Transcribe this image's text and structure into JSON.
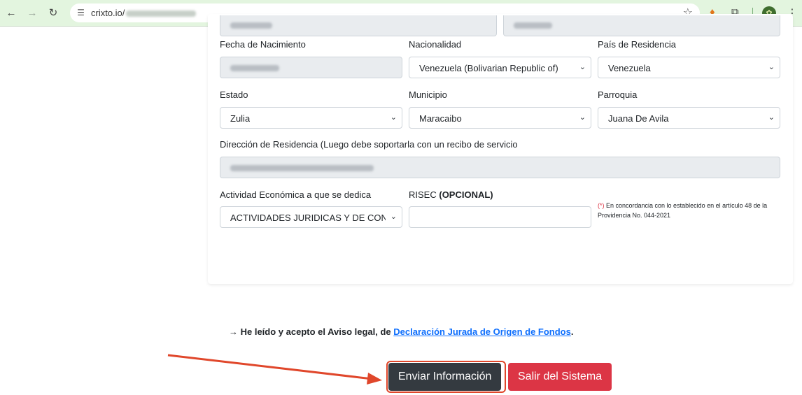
{
  "browser": {
    "url_visible": "crixto.io/",
    "back_icon": "←",
    "forward_icon": "→",
    "reload_icon": "↻",
    "site_info_icon": "☰",
    "star_icon": "☆",
    "fox_icon": "♦",
    "puzzle_icon": "⧉",
    "profile_icon": "✿",
    "menu_icon": "⋮"
  },
  "form": {
    "birth_date": {
      "label": "Fecha de Nacimiento"
    },
    "nationality": {
      "label": "Nacionalidad",
      "value": "Venezuela (Bolivarian Republic of)"
    },
    "country": {
      "label": "País de Residencia",
      "value": "Venezuela"
    },
    "state": {
      "label": "Estado",
      "value": "Zulia"
    },
    "municipality": {
      "label": "Municipio",
      "value": "Maracaibo"
    },
    "parish": {
      "label": "Parroquia",
      "value": "Juana De Avila"
    },
    "address": {
      "label": "Dirección de Residencia (Luego debe soportarla con un recibo de servicio"
    },
    "activity": {
      "label": "Actividad Económica a que se dedica",
      "value": "ACTIVIDADES JURIDICAS Y DE CONTABILIDAD"
    },
    "risec": {
      "label": "RISEC",
      "label_suffix": "(OPCIONAL)",
      "value": ""
    },
    "note_marker": "(*)",
    "note_text": " En concordancia con lo establecido en el artículo 48 de la Providencia No. 044-2021",
    "chevron": "⌄"
  },
  "footer": {
    "legal_prefix": "→ He leído y acepto el Aviso legal, de ",
    "legal_link": "Declaración Jurada de Origen de Fondos",
    "legal_suffix": ".",
    "send_button": "Enviar Información",
    "exit_button": "Salir del Sistema"
  },
  "colors": {
    "browser_bar": "#e3f5df",
    "send_button": "#343a40",
    "exit_button": "#dc3545",
    "annotation": "#e0472b",
    "link": "#0d6efd"
  }
}
